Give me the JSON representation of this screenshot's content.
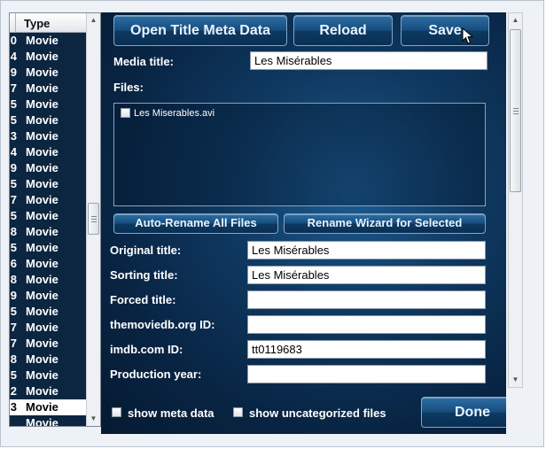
{
  "list": {
    "header": "Type",
    "rows": [
      {
        "idx": "0",
        "type": "Movie"
      },
      {
        "idx": "4",
        "type": "Movie"
      },
      {
        "idx": "9",
        "type": "Movie"
      },
      {
        "idx": "7",
        "type": "Movie"
      },
      {
        "idx": "5",
        "type": "Movie"
      },
      {
        "idx": "5",
        "type": "Movie"
      },
      {
        "idx": "3",
        "type": "Movie"
      },
      {
        "idx": "4",
        "type": "Movie"
      },
      {
        "idx": "9",
        "type": "Movie"
      },
      {
        "idx": "5",
        "type": "Movie"
      },
      {
        "idx": "7",
        "type": "Movie"
      },
      {
        "idx": "5",
        "type": "Movie"
      },
      {
        "idx": "8",
        "type": "Movie"
      },
      {
        "idx": "5",
        "type": "Movie"
      },
      {
        "idx": "6",
        "type": "Movie"
      },
      {
        "idx": "8",
        "type": "Movie"
      },
      {
        "idx": "9",
        "type": "Movie"
      },
      {
        "idx": "5",
        "type": "Movie"
      },
      {
        "idx": "7",
        "type": "Movie"
      },
      {
        "idx": "7",
        "type": "Movie"
      },
      {
        "idx": "8",
        "type": "Movie"
      },
      {
        "idx": "5",
        "type": "Movie"
      },
      {
        "idx": "2",
        "type": "Movie"
      },
      {
        "idx": "3",
        "type": "Movie"
      },
      {
        "idx": "",
        "type": "Movie"
      }
    ],
    "selected_index": 23
  },
  "toolbar": {
    "open_meta_label": "Open Title Meta Data",
    "reload_label": "Reload",
    "save_label": "Save"
  },
  "media": {
    "title_label": "Media title:",
    "title_value": "Les Misérables",
    "files_label": "Files:",
    "files": [
      {
        "name": "Les Miserables.avi",
        "checked": false
      }
    ]
  },
  "actions": {
    "auto_rename_label": "Auto-Rename All Files",
    "rename_wizard_label": "Rename Wizard for Selected"
  },
  "fields": [
    {
      "label": "Original title:",
      "value": "Les Misérables"
    },
    {
      "label": "Sorting title:",
      "value": "Les Misérables"
    },
    {
      "label": "Forced title:",
      "value": ""
    },
    {
      "label": "themoviedb.org ID:",
      "value": ""
    },
    {
      "label": "imdb.com ID:",
      "value": "tt0119683"
    },
    {
      "label": "Production year:",
      "value": ""
    }
  ],
  "footer": {
    "show_meta_label": "show meta data",
    "show_uncategorized_label": "show uncategorized files",
    "done_label": "Done"
  },
  "colors": {
    "panel_dark": "#082443",
    "panel_light": "#1d5c92",
    "button_top": "#2d6ea3",
    "button_bottom": "#0a2f52",
    "list_bg": "#0c2540"
  },
  "icons": {
    "cursor": "mouse-pointer-icon",
    "scroll_up": "chevron-up-icon",
    "scroll_down": "chevron-down-icon"
  }
}
